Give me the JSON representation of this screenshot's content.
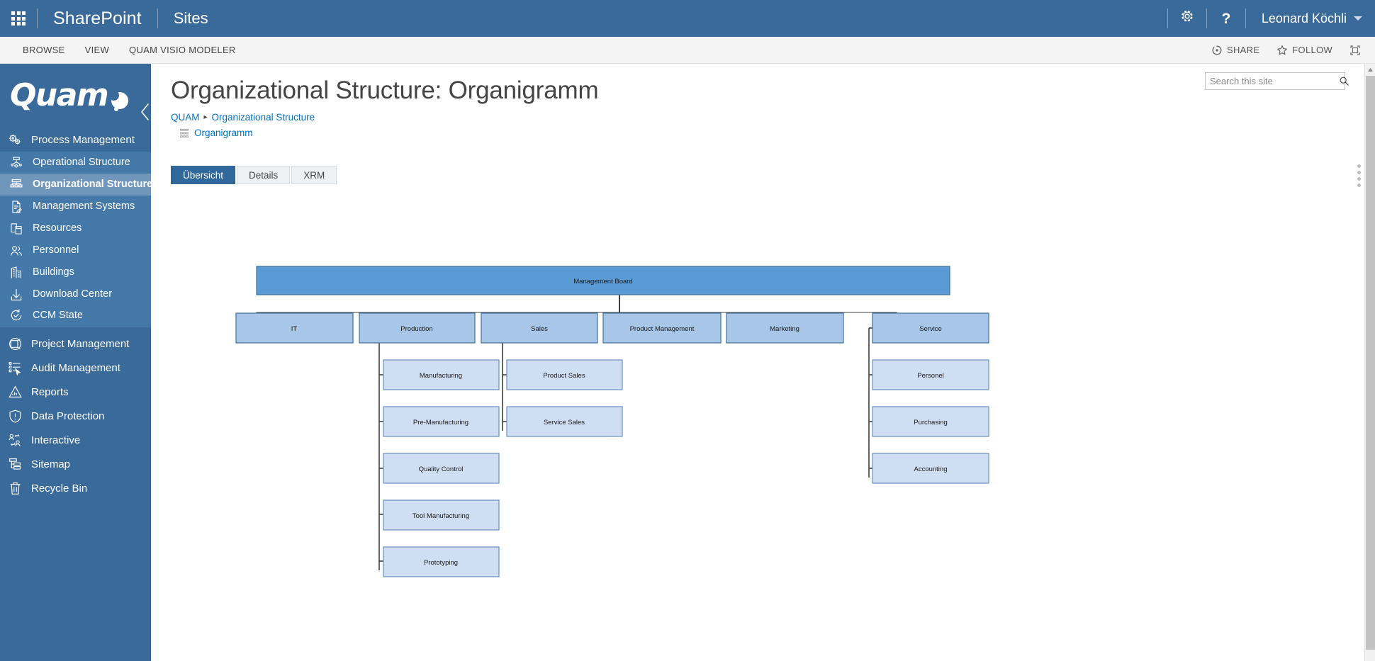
{
  "suite_bar": {
    "waffle_icon": "app-launcher-waffle-icon",
    "brand": "SharePoint",
    "site_link": "Sites",
    "settings_icon": "gear-icon",
    "help_icon": "question-mark-icon",
    "user_name": "Leonard Köchli",
    "user_caret_icon": "chevron-down-icon",
    "accent_color": "#3a6a99"
  },
  "ribbon": {
    "tabs": [
      {
        "label": "BROWSE"
      },
      {
        "label": "VIEW"
      },
      {
        "label": "QUAM VISIO MODELER"
      }
    ],
    "actions": [
      {
        "label": "SHARE",
        "icon": "share-circle-icon"
      },
      {
        "label": "FOLLOW",
        "icon": "star-outline-icon"
      }
    ],
    "focus_icon": "focus-on-content-icon"
  },
  "left_nav": {
    "logo_text": "Quam",
    "logo_icon": "quam-dot-logo",
    "collapse_icon": "chevron-left-icon",
    "groups": [
      {
        "name": "process-management",
        "shade": "a",
        "items": [
          {
            "label": "Process Management",
            "icon": "gears-icon",
            "level": 1,
            "active": false
          }
        ]
      },
      {
        "name": "process-management-children",
        "shade": "b",
        "items": [
          {
            "label": "Operational Structure",
            "icon": "flowchart-icon",
            "level": 2,
            "active": false
          },
          {
            "label": "Organizational Structure",
            "icon": "org-tree-icon",
            "level": 2,
            "active": true
          },
          {
            "label": "Management Systems",
            "icon": "document-edit-icon",
            "level": 2,
            "active": false
          },
          {
            "label": "Resources",
            "icon": "resources-icon",
            "level": 2,
            "active": false
          },
          {
            "label": "Personnel",
            "icon": "people-icon",
            "level": 2,
            "active": false
          },
          {
            "label": "Buildings",
            "icon": "building-icon",
            "level": 2,
            "active": false
          },
          {
            "label": "Download Center",
            "icon": "download-arrow-icon",
            "level": 2,
            "active": false
          },
          {
            "label": "CCM State",
            "icon": "refresh-check-icon",
            "level": 2,
            "active": false
          }
        ]
      },
      {
        "name": "other-modules",
        "shade": "c",
        "items": [
          {
            "label": "Project Management",
            "icon": "globe-box-icon",
            "level": 1,
            "active": false
          },
          {
            "label": "Audit Management",
            "icon": "checklist-cursor-icon",
            "level": 1,
            "active": false
          },
          {
            "label": "Reports",
            "icon": "chart-triangle-icon",
            "level": 1,
            "active": false
          },
          {
            "label": "Data Protection",
            "icon": "shield-exclamation-icon",
            "level": 1,
            "active": false
          },
          {
            "label": "Interactive",
            "icon": "user-exchange-icon",
            "level": 1,
            "active": false
          },
          {
            "label": "Sitemap",
            "icon": "sitemap-icon",
            "level": 1,
            "active": false
          },
          {
            "label": "Recycle Bin",
            "icon": "trash-icon",
            "level": 1,
            "active": false
          }
        ]
      }
    ]
  },
  "page": {
    "title": "Organizational Structure: Organigramm",
    "breadcrumb": [
      {
        "label": "QUAM"
      },
      {
        "label": "Organizational Structure"
      }
    ],
    "breadcrumb_separator": "▸",
    "current_item": {
      "label": "Organigramm",
      "icon": "org-chart-icon"
    },
    "tabs": [
      {
        "label": "Übersicht",
        "active": true
      },
      {
        "label": "Details",
        "active": false
      },
      {
        "label": "XRM",
        "active": false
      }
    ]
  },
  "search": {
    "placeholder": "Search this site",
    "value": "",
    "icon": "magnifier-icon"
  },
  "scrollbar": {
    "up_arrow_icon": "triangle-up-icon",
    "thumb": "vertical-scroll-thumb",
    "drag_handle": "vertical-dots-drag-handle"
  },
  "chart_data": {
    "type": "diagram",
    "title": "Organigramm",
    "colors": {
      "root_fill": "#5b9bd5",
      "root_stroke": "#41719c",
      "level1_fill": "#a8c6e8",
      "level1_stroke": "#41719c",
      "level2_fill": "#cfdef2",
      "level2_stroke": "#6b92c0",
      "connector": "#3f3f3f",
      "text": "#1a1a1a"
    },
    "root": {
      "id": "mgmt-board",
      "label": "Management Board"
    },
    "level1": [
      {
        "id": "it",
        "label": "IT"
      },
      {
        "id": "production",
        "label": "Production"
      },
      {
        "id": "sales",
        "label": "Sales"
      },
      {
        "id": "product-management",
        "label": "Product Management"
      },
      {
        "id": "marketing",
        "label": "Marketing"
      },
      {
        "id": "service",
        "label": "Service"
      }
    ],
    "level2": {
      "production": [
        {
          "id": "manufacturing",
          "label": "Manufacturing"
        },
        {
          "id": "pre-manufacturing",
          "label": "Pre-Manufacturing"
        },
        {
          "id": "quality-control",
          "label": "Quality Control"
        },
        {
          "id": "tool-manufacturing",
          "label": "Tool Manufacturing"
        },
        {
          "id": "prototyping",
          "label": "Prototyping"
        }
      ],
      "sales": [
        {
          "id": "product-sales",
          "label": "Product Sales"
        },
        {
          "id": "service-sales",
          "label": "Service Sales"
        }
      ],
      "service": [
        {
          "id": "personel",
          "label": "Personel"
        },
        {
          "id": "purchasing",
          "label": "Purchasing"
        },
        {
          "id": "accounting",
          "label": "Accounting"
        }
      ]
    }
  }
}
